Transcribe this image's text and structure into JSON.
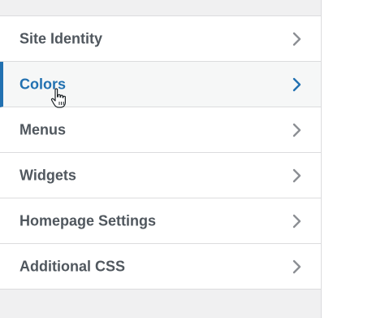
{
  "menu": {
    "items": [
      {
        "label": "Site Identity",
        "icon": "chevron-right-icon"
      },
      {
        "label": "Colors",
        "icon": "chevron-right-icon"
      },
      {
        "label": "Menus",
        "icon": "chevron-right-icon"
      },
      {
        "label": "Widgets",
        "icon": "chevron-right-icon"
      },
      {
        "label": "Homepage Settings",
        "icon": "chevron-right-icon"
      },
      {
        "label": "Additional CSS",
        "icon": "chevron-right-icon"
      }
    ],
    "active_index": 1
  },
  "colors": {
    "accent": "#2271b1",
    "text": "#50575e",
    "background": "#f0f0f1"
  },
  "cursor": {
    "icon": "hand-pointer-icon"
  }
}
